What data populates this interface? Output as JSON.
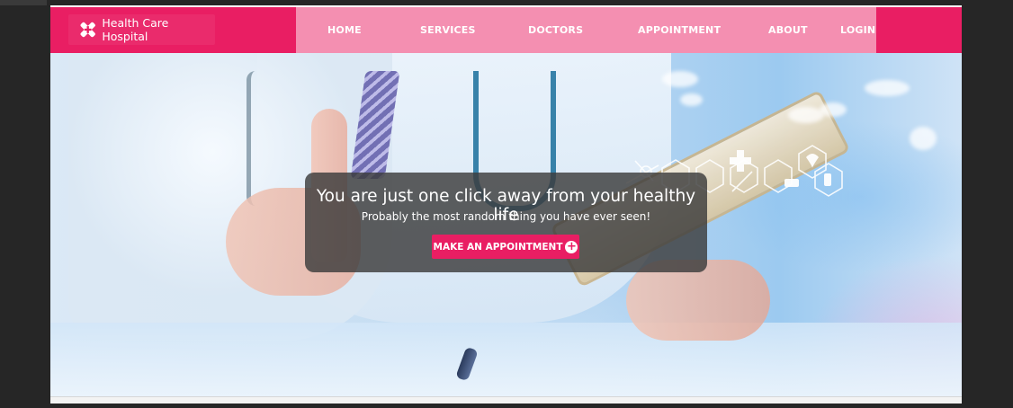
{
  "brand": {
    "name": "Health Care Hospital",
    "logo_icon": "cross-plus-logo-icon"
  },
  "nav": {
    "items": [
      {
        "label": "HOME"
      },
      {
        "label": "SERVICES"
      },
      {
        "label": "DOCTORS"
      },
      {
        "label": "APPOINTMENT"
      },
      {
        "label": "ABOUT"
      },
      {
        "label": "LOGIN"
      }
    ]
  },
  "hero": {
    "headline": "You are just one click away from your healthy life",
    "subline": "Probably the most random thing you have ever seen!",
    "cta_label": "MAKE AN APPOINTMENT",
    "cta_icon": "plus-circle-icon",
    "cta_icon_glyph": "+"
  },
  "colors": {
    "primary": "#e91e63",
    "nav_light": "#f48fb1",
    "caption_bg": "#3c3c3c",
    "white": "#ffffff"
  }
}
